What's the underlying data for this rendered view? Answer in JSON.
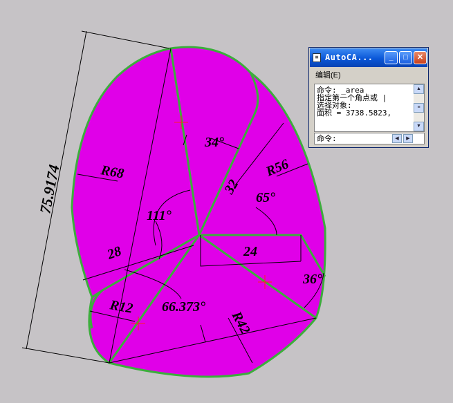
{
  "drawing": {
    "colors": {
      "background": "#c6c3c6",
      "fill": "#e000e8",
      "outline": "#3cae3c",
      "lines": "#000000",
      "center_marks": "#ff0000"
    },
    "dimensions": {
      "overall": "75.9174",
      "r68": "R68",
      "r56": "R56",
      "r42": "R42",
      "r12": "R12",
      "ang34": "34°",
      "ang65": "65°",
      "ang111": "111°",
      "ang36": "36°",
      "ang66": "66.373°",
      "len32": "32",
      "len28": "28",
      "len24": "24"
    }
  },
  "window": {
    "title": "AutoCA...",
    "icon": "window-icon",
    "menu": "编辑(E)",
    "log_lines": [
      "命令: _area",
      "指定第一个角点或 |",
      "选择对象:",
      "面积 = 3738.5823,"
    ],
    "command_label": "命令:"
  }
}
